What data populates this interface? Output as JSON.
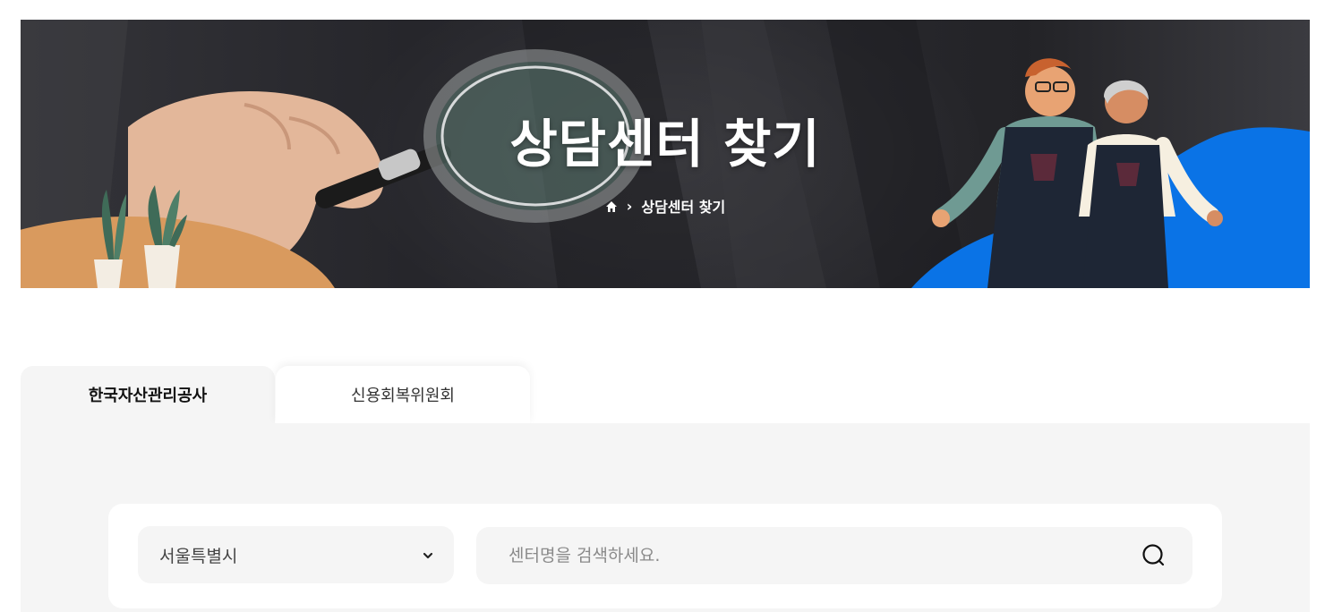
{
  "hero": {
    "title": "상담센터 찾기",
    "breadcrumb": {
      "home_icon": "home-icon",
      "separator": "›",
      "current": "상담센터 찾기"
    }
  },
  "tabs": [
    {
      "label": "한국자산관리공사",
      "active": true
    },
    {
      "label": "신용회복위원회",
      "active": false
    }
  ],
  "search": {
    "region_value": "서울특별시",
    "region_icon": "chevron-down-icon",
    "placeholder": "센터명을 검색하세요.",
    "search_icon": "search-icon"
  },
  "colors": {
    "accent_blue": "#0a73e6",
    "plant_table": "#d99a5e",
    "panel_bg": "#f5f5f5",
    "apron": "#1e2635"
  }
}
